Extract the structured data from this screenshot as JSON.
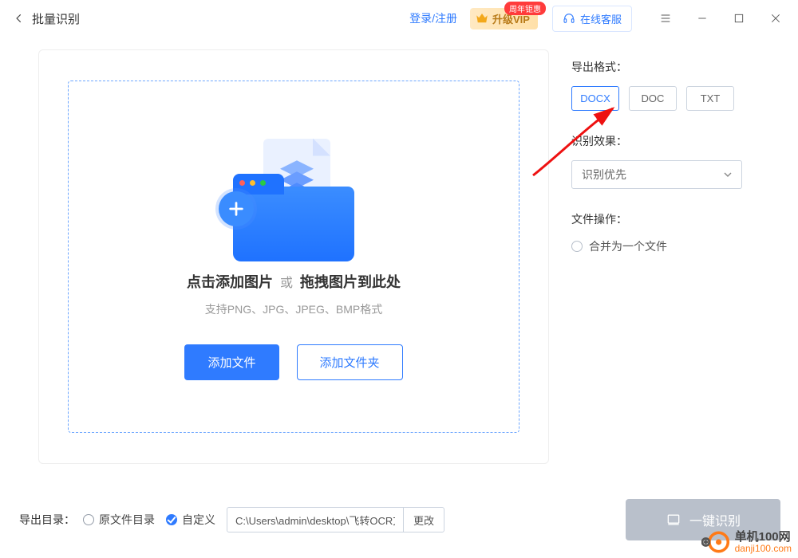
{
  "titlebar": {
    "title": "批量识别",
    "login": "登录/注册",
    "vip_badge": "周年钜惠",
    "vip_label": "升级VIP",
    "support": "在线客服"
  },
  "dropzone": {
    "title_click": "点击添加图片",
    "title_sep": "或",
    "title_drag": "拖拽图片到此处",
    "subtitle": "支持PNG、JPG、JPEG、BMP格式",
    "add_file": "添加文件",
    "add_folder": "添加文件夹"
  },
  "side": {
    "export_format_label": "导出格式：",
    "formats": {
      "docx": "DOCX",
      "doc": "DOC",
      "txt": "TXT"
    },
    "recognition_label": "识别效果：",
    "recognition_value": "识别优先",
    "file_op_label": "文件操作：",
    "merge_label": "合并为一个文件"
  },
  "bottom": {
    "export_dir_label": "导出目录：",
    "orig_dir": "原文件目录",
    "custom_dir": "自定义",
    "path_value": "C:\\Users\\admin\\desktop\\飞转OCR文字识别",
    "change": "更改",
    "recognize": "一键识别"
  },
  "watermark": {
    "line1": "单机100网",
    "line2": "danji100.com"
  }
}
